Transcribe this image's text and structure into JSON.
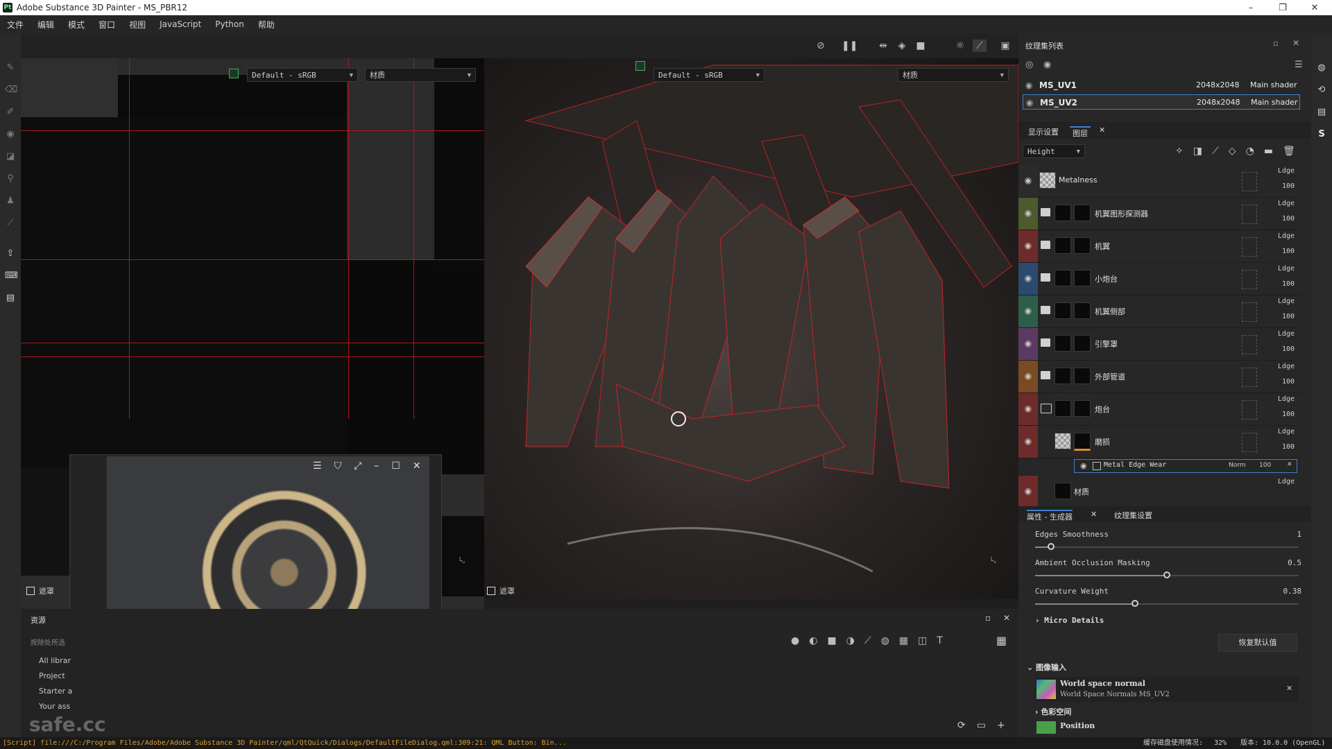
{
  "window": {
    "title": "Adobe Substance 3D Painter - MS_PBR12",
    "logo": "Pt",
    "minimize": "–",
    "maximize": "❐",
    "close": "✕"
  },
  "menu": [
    "文件",
    "编辑",
    "模式",
    "窗口",
    "视图",
    "JavaScript",
    "Python",
    "帮助"
  ],
  "viewport2d": {
    "colorspace": "Default - sRGB",
    "channel": "材质",
    "mask_label": "遮罩"
  },
  "viewport3d": {
    "colorspace": "Default - sRGB",
    "channel": "材质",
    "mask_label": "遮罩"
  },
  "texture_sets": {
    "title": "纹理集列表",
    "items": [
      {
        "name": "MS_UV1",
        "res": "2048x2048",
        "shader": "Main shader",
        "selected": false
      },
      {
        "name": "MS_UV2",
        "res": "2048x2048",
        "shader": "Main shader",
        "selected": true
      }
    ]
  },
  "layers_panel": {
    "tabs": [
      "显示设置",
      "图层"
    ],
    "channel_select": "Height",
    "layers": [
      {
        "name": "Metalness",
        "blend": "Ldge",
        "opacity": "100",
        "color": "#2b2b2b",
        "type": "fill"
      },
      {
        "name": "机翼图形探测器",
        "blend": "Ldge",
        "opacity": "100",
        "color": "#4c5a2e",
        "type": "folder"
      },
      {
        "name": "机翼",
        "blend": "Ldge",
        "opacity": "100",
        "color": "#6e2b2b",
        "type": "folder"
      },
      {
        "name": "小炮台",
        "blend": "Ldge",
        "opacity": "100",
        "color": "#2c4a6e",
        "type": "folder"
      },
      {
        "name": "机翼侧部",
        "blend": "Ldge",
        "opacity": "100",
        "color": "#2d5e4a",
        "type": "folder"
      },
      {
        "name": "引擎罩",
        "blend": "Ldge",
        "opacity": "100",
        "color": "#5b3a62",
        "type": "folder"
      },
      {
        "name": "外部管道",
        "blend": "Ldge",
        "opacity": "100",
        "color": "#7a4a22",
        "type": "folder"
      },
      {
        "name": "炮台",
        "blend": "Ldge",
        "opacity": "100",
        "color": "#6e2b2b",
        "type": "folder"
      },
      {
        "name": "磨损",
        "blend": "Ldge",
        "opacity": "100",
        "color": "#6e2b2b",
        "type": "fill"
      }
    ],
    "effect": {
      "name": "Metal Edge Wear",
      "blend": "Norm",
      "opacity": "100"
    },
    "last_layer": {
      "name": "材质",
      "blend": "Ldge"
    }
  },
  "properties": {
    "tabs": [
      "属性 - 生成器",
      "纹理集设置"
    ],
    "params": [
      {
        "label": "Edges Smoothness",
        "value": "1",
        "fraction": 0.06
      },
      {
        "label": "Ambient Occlusion Masking",
        "value": "0.5",
        "fraction": 0.5
      },
      {
        "label": "Curvature Weight",
        "value": "0.38",
        "fraction": 0.38
      }
    ],
    "micro_details": "Micro Details",
    "reset": "恢复默认值",
    "image_input_title": "图像输入",
    "input_name": "World space normal",
    "input_sub": "World Space Normals MS_UV2",
    "colorspace": "色彩空间",
    "position": "Position"
  },
  "assets": {
    "title": "资源",
    "filter": "按除处所选",
    "items": [
      "All librar",
      "Project",
      "Starter a",
      "Your ass"
    ]
  },
  "status": {
    "script": "[Script] file:///C:/Program Files/Adobe/Adobe Substance 3D Painter/qml/QtQuick/Dialogs/DefaultFileDialog.qml:309:21: QML Button: Bin...",
    "cache": "缓存磁盘使用情况:",
    "cache_value": "32%",
    "version": "版本: 10.0.0 (OpenGL)"
  },
  "watermark": "safe.cc"
}
